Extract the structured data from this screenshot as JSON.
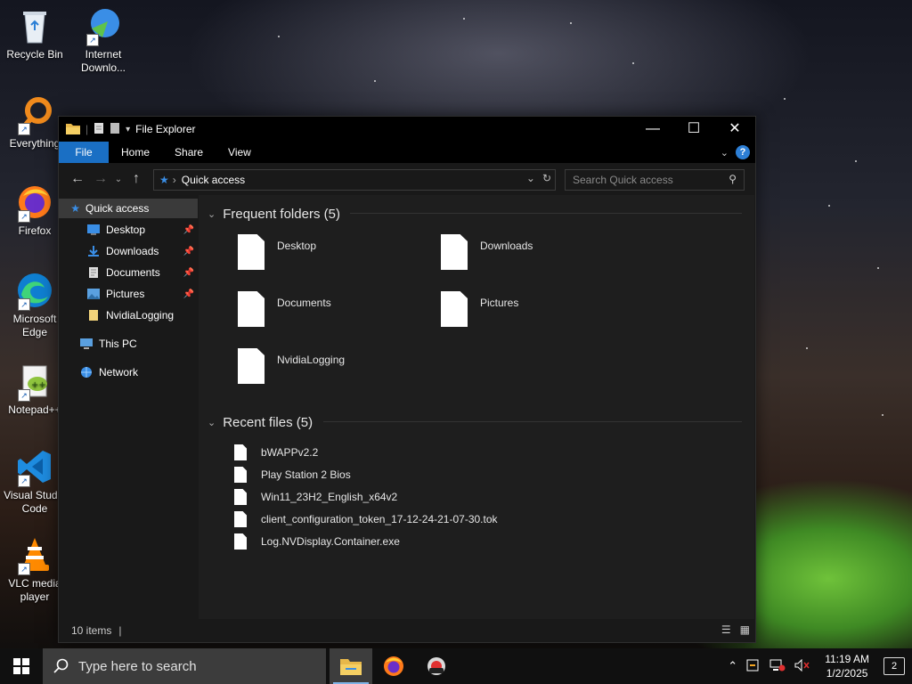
{
  "desktop": {
    "icons": [
      {
        "label": "Recycle Bin",
        "icon": "recycle-bin-icon"
      },
      {
        "label": "Internet Downlo...",
        "icon": "internet-download-manager-icon"
      },
      {
        "label": "Everything",
        "icon": "everything-search-icon"
      },
      {
        "label": "Firefox",
        "icon": "firefox-icon"
      },
      {
        "label": "Microsoft Edge",
        "icon": "edge-icon"
      },
      {
        "label": "Notepad++",
        "icon": "notepad-plus-plus-icon"
      },
      {
        "label": "Visual Studio Code",
        "icon": "vscode-icon"
      },
      {
        "label": "VLC media player",
        "icon": "vlc-icon"
      }
    ]
  },
  "window": {
    "title": "File Explorer",
    "ribbon_tabs": [
      "File",
      "Home",
      "Share",
      "View"
    ],
    "address": "Quick access",
    "search_placeholder": "Search Quick access",
    "sidebar": {
      "quick_access": "Quick access",
      "pinned": [
        {
          "label": "Desktop",
          "pinned": true
        },
        {
          "label": "Downloads",
          "pinned": true
        },
        {
          "label": "Documents",
          "pinned": true
        },
        {
          "label": "Pictures",
          "pinned": true
        },
        {
          "label": "NvidiaLogging",
          "pinned": false
        }
      ],
      "this_pc": "This PC",
      "network": "Network"
    },
    "frequent": {
      "heading": "Frequent folders (5)",
      "items": [
        "Desktop",
        "Downloads",
        "Documents",
        "Pictures",
        "NvidiaLogging"
      ]
    },
    "recent": {
      "heading": "Recent files (5)",
      "items": [
        "bWAPPv2.2",
        "Play Station 2 Bios",
        "Win11_23H2_English_x64v2",
        "client_configuration_token_17-12-24-21-07-30.tok",
        "Log.NVDisplay.Container.exe"
      ]
    },
    "status": "10 items"
  },
  "taskbar": {
    "search_placeholder": "Type here to search",
    "apps": [
      "file-explorer-icon",
      "firefox-icon",
      "gyroflow-app-icon"
    ],
    "time": "11:19 AM",
    "date": "1/2/2025",
    "notifications": "2"
  },
  "colors": {
    "accent": "#1a6fc4",
    "window_bg": "#191919",
    "taskbar": "#101010"
  }
}
